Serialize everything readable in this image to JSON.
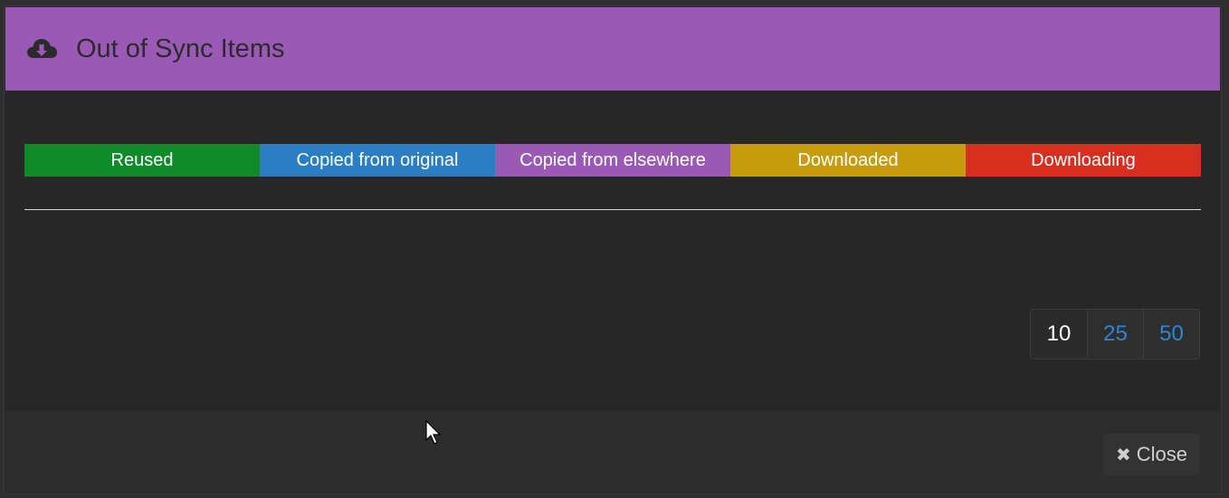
{
  "modal": {
    "title": "Out of Sync Items",
    "header_color": "#9b59b6",
    "header_icon": "cloud-download-icon"
  },
  "legend": [
    {
      "label": "Reused",
      "color": "#0e8a28"
    },
    {
      "label": "Copied from original",
      "color": "#2a7fc4"
    },
    {
      "label": "Copied from elsewhere",
      "color": "#9b59b6"
    },
    {
      "label": "Downloaded",
      "color": "#c79c0c"
    },
    {
      "label": "Downloading",
      "color": "#d62f1f"
    }
  ],
  "pagination": {
    "sizes": [
      "10",
      "25",
      "50"
    ],
    "active": "10"
  },
  "footer": {
    "close_label": "Close",
    "close_icon": "times-icon"
  }
}
